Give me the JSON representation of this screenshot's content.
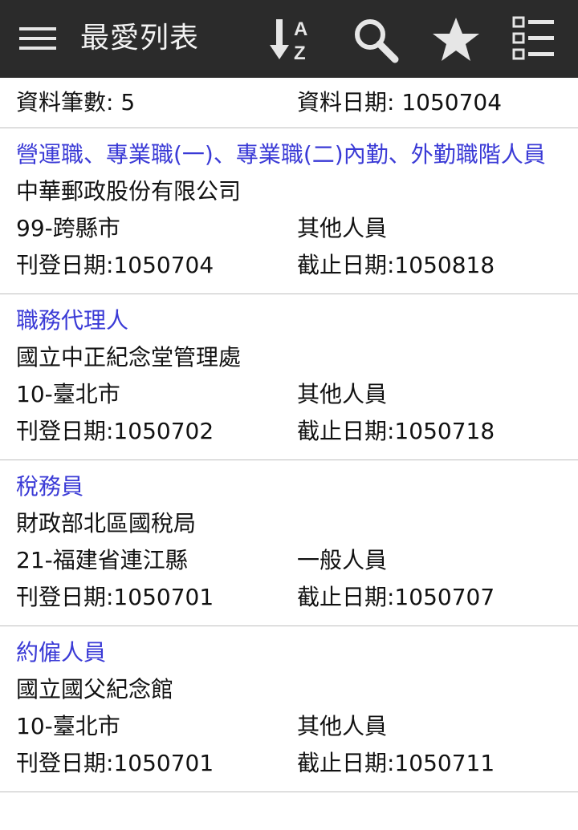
{
  "appbar": {
    "title": "最愛列表",
    "actions": [
      "sort-az-icon",
      "search-icon",
      "star-icon",
      "list-icon"
    ]
  },
  "summary": {
    "count_label": "資料筆數: 5",
    "date_label": "資料日期: 1050704"
  },
  "items": [
    {
      "title": "營運職、專業職(一)、專業職(二)內勤、外勤職階人員",
      "org": "中華郵政股份有限公司",
      "location": "99-跨縣市",
      "category": "其他人員",
      "post_date": "刊登日期:1050704",
      "end_date": "截止日期:1050818"
    },
    {
      "title": "職務代理人",
      "org": "國立中正紀念堂管理處",
      "location": "10-臺北市",
      "category": "其他人員",
      "post_date": "刊登日期:1050702",
      "end_date": "截止日期:1050718"
    },
    {
      "title": "稅務員",
      "org": "財政部北區國稅局",
      "location": "21-福建省連江縣",
      "category": "一般人員",
      "post_date": "刊登日期:1050701",
      "end_date": "截止日期:1050707"
    },
    {
      "title": "約僱人員",
      "org": "國立國父紀念館",
      "location": "10-臺北市",
      "category": "其他人員",
      "post_date": "刊登日期:1050701",
      "end_date": "截止日期:1050711"
    }
  ],
  "colors": {
    "appbar_bg": "#2b2b2b",
    "title_link": "#3a3ad6",
    "divider": "#bdbdbd"
  }
}
